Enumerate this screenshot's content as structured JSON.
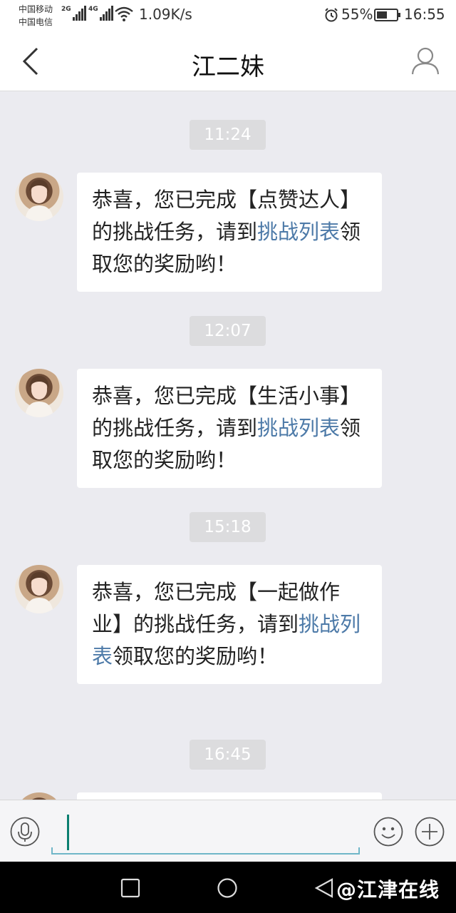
{
  "status_bar": {
    "carrier_1": "中国移动",
    "carrier_2": "中国电信",
    "sim1_network": "2G",
    "sim2_network": "4G",
    "speed": "1.09K/s",
    "battery_percent": "55%",
    "battery_level": 0.55,
    "time": "16:55",
    "icons": [
      "signal-icon",
      "wifi-icon",
      "alarm-icon",
      "battery-icon"
    ]
  },
  "header": {
    "title": "江二妹",
    "back_icon": "chevron-left-icon",
    "profile_icon": "person-icon"
  },
  "messages": [
    {
      "time": "11:24",
      "text_parts": [
        "恭喜，您已完成【点赞达人】的挑战任务，请到",
        "挑战列表",
        "领取您的奖励哟！"
      ]
    },
    {
      "time": "12:07",
      "text_parts": [
        "恭喜，您已完成【生活小事】的挑战任务，请到",
        "挑战列表",
        "领取您的奖励哟！"
      ]
    },
    {
      "time": "15:18",
      "text_parts": [
        "恭喜，您已完成【一起做作业】的挑战任务，请到",
        "挑战列表",
        "领取您的奖励哟！"
      ]
    },
    {
      "time": "16:45",
      "text_parts": [
        "",
        "",
        ""
      ]
    }
  ],
  "input_bar": {
    "voice_icon": "microphone-icon",
    "emoji_icon": "smiley-icon",
    "more_icon": "plus-icon",
    "input_value": ""
  },
  "system_nav": {
    "icons": [
      "recent-apps-icon",
      "home-icon",
      "back-icon"
    ],
    "watermark": "@江津在线"
  },
  "colors": {
    "background": "#ebebf0",
    "bubble": "#ffffff",
    "link": "#4d7aa8",
    "time_pill": "#dcdcde"
  }
}
